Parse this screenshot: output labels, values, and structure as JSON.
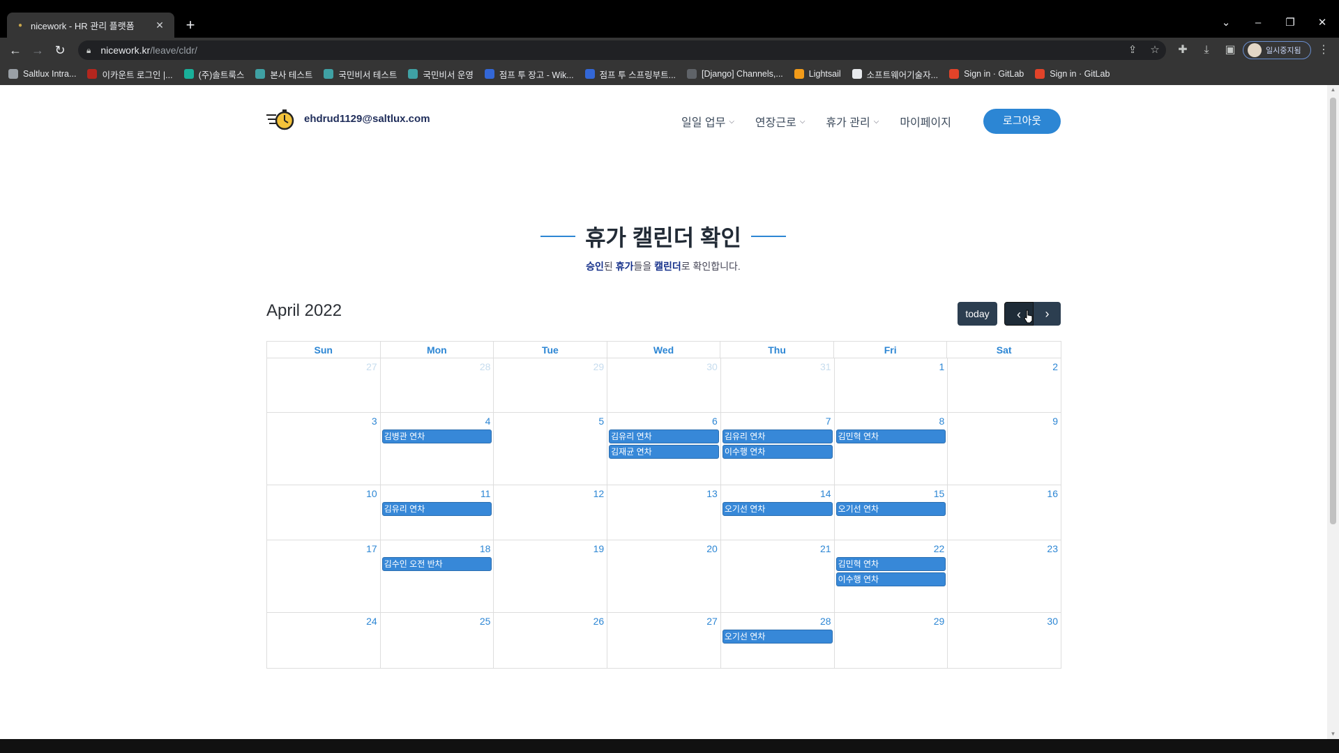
{
  "browser": {
    "tab_title": "nicework - HR 관리 플랫폼",
    "new_tab_symbol": "+",
    "url_host": "nicework.kr",
    "url_path": "/leave/cldr/",
    "profile_label": "일시중지됨",
    "bookmarks": [
      {
        "label": "Saltlux Intra...",
        "color": "#9aa0a6"
      },
      {
        "label": "이카운트 로그인 |...",
        "color": "#b3261e"
      },
      {
        "label": "(주)솔트룩스",
        "color": "#19b09a"
      },
      {
        "label": "본사 테스트",
        "color": "#3fa1a4"
      },
      {
        "label": "국민비서 테스트",
        "color": "#3fa1a4"
      },
      {
        "label": "국민비서 운영",
        "color": "#3fa1a4"
      },
      {
        "label": "점프 투 장고 - Wik...",
        "color": "#3367d6"
      },
      {
        "label": "점프 투 스프링부트...",
        "color": "#3367d6"
      },
      {
        "label": "[Django] Channels,...",
        "color": "#5f6368"
      },
      {
        "label": "Lightsail",
        "color": "#f29b19"
      },
      {
        "label": "소프트웨어기술자...",
        "color": "#e8eaed"
      },
      {
        "label": "Sign in · GitLab",
        "color": "#e24329"
      },
      {
        "label": "Sign in · GitLab",
        "color": "#e24329"
      }
    ]
  },
  "header": {
    "email": "ehdrud1129@saltlux.com",
    "nav": [
      "일일 업무",
      "연장근로",
      "휴가 관리",
      "마이페이지"
    ],
    "logout": "로그아웃"
  },
  "section": {
    "title": "휴가 캘린더 확인",
    "subtitle_parts": [
      "승인",
      "된 ",
      "휴가",
      "들을 ",
      "캘린더",
      "로 확인합니다."
    ]
  },
  "calendar": {
    "month_title": "April 2022",
    "today_label": "today",
    "prev_symbol": "‹",
    "next_symbol": "›",
    "days_of_week": [
      "Sun",
      "Mon",
      "Tue",
      "Wed",
      "Thu",
      "Fri",
      "Sat"
    ],
    "weeks": [
      [
        {
          "n": "27",
          "other": true,
          "ev": []
        },
        {
          "n": "28",
          "other": true,
          "ev": []
        },
        {
          "n": "29",
          "other": true,
          "ev": []
        },
        {
          "n": "30",
          "other": true,
          "ev": []
        },
        {
          "n": "31",
          "other": true,
          "ev": []
        },
        {
          "n": "1",
          "ev": []
        },
        {
          "n": "2",
          "ev": []
        }
      ],
      [
        {
          "n": "3",
          "ev": []
        },
        {
          "n": "4",
          "ev": [
            "김병관 연차"
          ]
        },
        {
          "n": "5",
          "ev": []
        },
        {
          "n": "6",
          "ev": [
            "김유리 연차",
            "김재균 연차"
          ]
        },
        {
          "n": "7",
          "ev": [
            "김유리 연차",
            "이수행 연차"
          ]
        },
        {
          "n": "8",
          "ev": [
            "김민혁 연차"
          ]
        },
        {
          "n": "9",
          "ev": []
        }
      ],
      [
        {
          "n": "10",
          "ev": []
        },
        {
          "n": "11",
          "ev": [
            "김유리 연차"
          ]
        },
        {
          "n": "12",
          "ev": []
        },
        {
          "n": "13",
          "ev": []
        },
        {
          "n": "14",
          "ev": [
            "오기선 연차"
          ]
        },
        {
          "n": "15",
          "ev": [
            "오기선 연차"
          ]
        },
        {
          "n": "16",
          "ev": []
        }
      ],
      [
        {
          "n": "17",
          "ev": []
        },
        {
          "n": "18",
          "ev": [
            "김수인 오전 반차"
          ]
        },
        {
          "n": "19",
          "ev": []
        },
        {
          "n": "20",
          "ev": []
        },
        {
          "n": "21",
          "ev": []
        },
        {
          "n": "22",
          "ev": [
            "김민혁 연차",
            "이수행 연차"
          ]
        },
        {
          "n": "23",
          "ev": []
        }
      ],
      [
        {
          "n": "24",
          "ev": []
        },
        {
          "n": "25",
          "ev": []
        },
        {
          "n": "26",
          "ev": []
        },
        {
          "n": "27",
          "ev": []
        },
        {
          "n": "28",
          "ev": [
            "오기선 연차"
          ]
        },
        {
          "n": "29",
          "ev": []
        },
        {
          "n": "30",
          "ev": []
        }
      ]
    ],
    "week_heights": [
      78,
      104,
      79,
      104,
      80
    ]
  }
}
